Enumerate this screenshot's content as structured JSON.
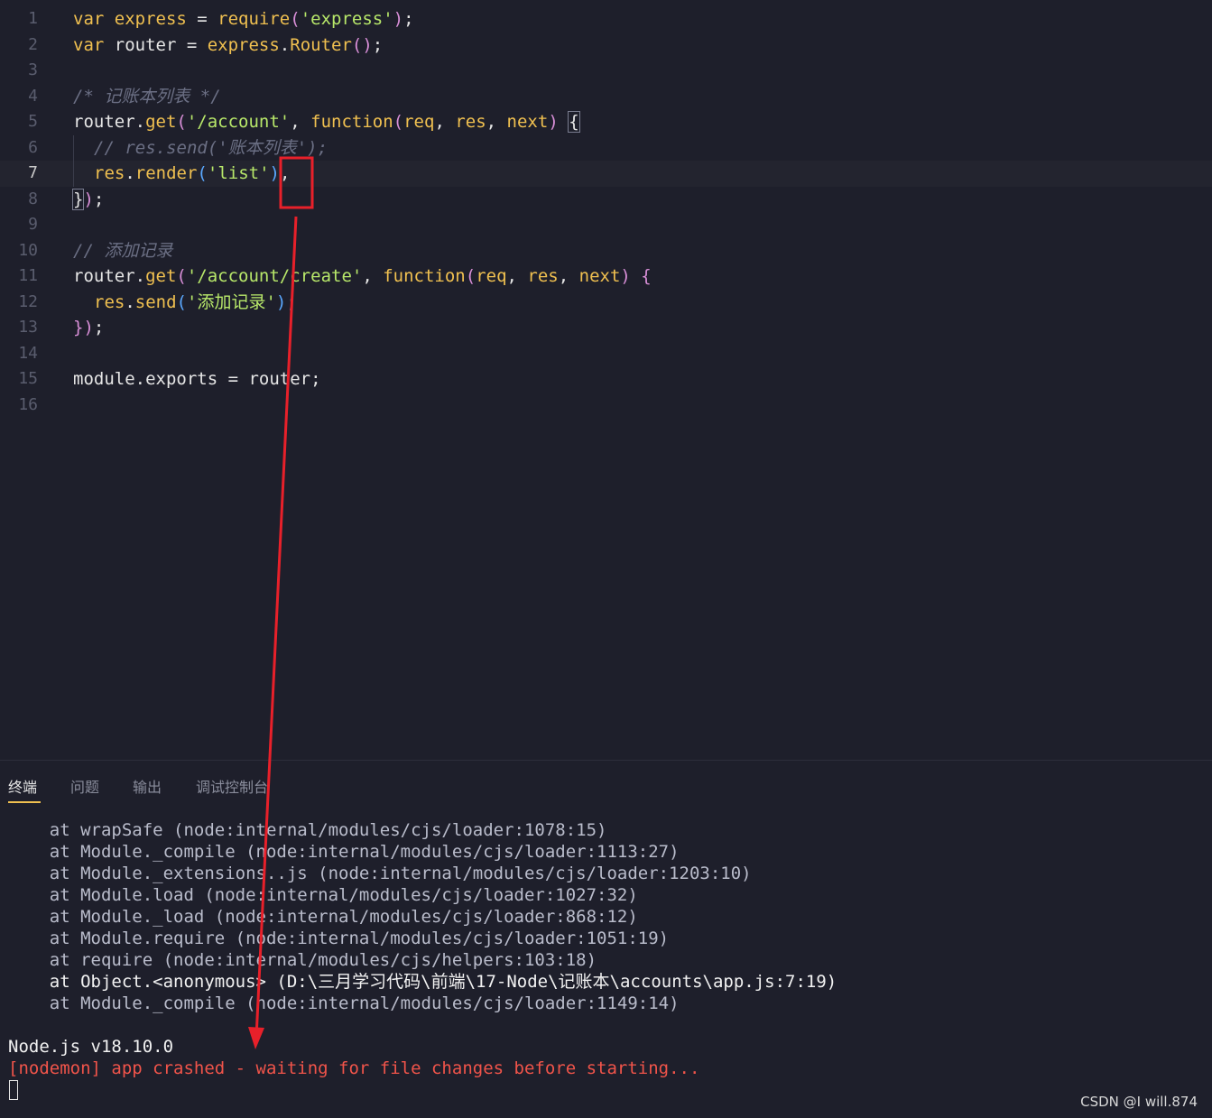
{
  "editor": {
    "lines": [
      {
        "n": "1",
        "indent": 0,
        "tokens": [
          [
            "kw",
            "var "
          ],
          [
            "fn",
            "express"
          ],
          [
            "punc",
            " = "
          ],
          [
            "fn",
            "require"
          ],
          [
            "paren",
            "("
          ],
          [
            "str",
            "'express'"
          ],
          [
            "paren",
            ")"
          ],
          [
            "punc",
            ";"
          ]
        ]
      },
      {
        "n": "2",
        "indent": 0,
        "tokens": [
          [
            "kw",
            "var "
          ],
          [
            "punc",
            "router = "
          ],
          [
            "fn",
            "express"
          ],
          [
            "punc",
            "."
          ],
          [
            "fn",
            "Router"
          ],
          [
            "paren",
            "()"
          ],
          [
            "punc",
            ";"
          ]
        ]
      },
      {
        "n": "3",
        "indent": 0,
        "tokens": []
      },
      {
        "n": "4",
        "indent": 0,
        "tokens": [
          [
            "cm",
            "/* 记账本列表 */"
          ]
        ]
      },
      {
        "n": "5",
        "indent": 0,
        "tokens": [
          [
            "punc",
            "router."
          ],
          [
            "fn",
            "get"
          ],
          [
            "paren",
            "("
          ],
          [
            "str",
            "'/account'"
          ],
          [
            "punc",
            ", "
          ],
          [
            "kw",
            "function"
          ],
          [
            "paren",
            "("
          ],
          [
            "param",
            "req"
          ],
          [
            "punc",
            ", "
          ],
          [
            "param",
            "res"
          ],
          [
            "punc",
            ", "
          ],
          [
            "param",
            "next"
          ],
          [
            "paren",
            ")"
          ],
          [
            "punc",
            " "
          ],
          [
            "bm",
            "{"
          ]
        ]
      },
      {
        "n": "6",
        "indent": 1,
        "tokens": [
          [
            "cm",
            "// res.send('账本列表');"
          ]
        ]
      },
      {
        "n": "7",
        "indent": 1,
        "tokens": [
          [
            "param",
            "res"
          ],
          [
            "punc",
            "."
          ],
          [
            "fn",
            "render"
          ],
          [
            "paren2",
            "("
          ],
          [
            "str",
            "'list'"
          ],
          [
            "paren2",
            ")"
          ],
          [
            "punc",
            ","
          ]
        ]
      },
      {
        "n": "8",
        "indent": 0,
        "tokens": [
          [
            "bm",
            "}"
          ],
          [
            "paren",
            ")"
          ],
          [
            "punc",
            ";"
          ]
        ]
      },
      {
        "n": "9",
        "indent": 0,
        "tokens": []
      },
      {
        "n": "10",
        "indent": 0,
        "tokens": [
          [
            "cm",
            "// 添加记录"
          ]
        ]
      },
      {
        "n": "11",
        "indent": 0,
        "tokens": [
          [
            "punc",
            "router."
          ],
          [
            "fn",
            "get"
          ],
          [
            "paren",
            "("
          ],
          [
            "str",
            "'/account/create'"
          ],
          [
            "punc",
            ", "
          ],
          [
            "kw",
            "function"
          ],
          [
            "paren",
            "("
          ],
          [
            "param",
            "req"
          ],
          [
            "punc",
            ", "
          ],
          [
            "param",
            "res"
          ],
          [
            "punc",
            ", "
          ],
          [
            "param",
            "next"
          ],
          [
            "paren",
            ")"
          ],
          [
            "punc",
            " "
          ],
          [
            "paren",
            "{"
          ]
        ]
      },
      {
        "n": "12",
        "indent": 1,
        "tokens": [
          [
            "param",
            "res"
          ],
          [
            "punc",
            "."
          ],
          [
            "fn",
            "send"
          ],
          [
            "paren2",
            "("
          ],
          [
            "str",
            "'添加记录'"
          ],
          [
            "paren2",
            ")"
          ],
          [
            "punc",
            ";"
          ]
        ]
      },
      {
        "n": "13",
        "indent": 0,
        "tokens": [
          [
            "paren",
            "}"
          ],
          [
            "paren",
            ")"
          ],
          [
            "punc",
            ";"
          ]
        ]
      },
      {
        "n": "14",
        "indent": 0,
        "tokens": []
      },
      {
        "n": "15",
        "indent": 0,
        "tokens": [
          [
            "punc",
            "module.exports = router;"
          ]
        ]
      },
      {
        "n": "16",
        "indent": 0,
        "tokens": []
      }
    ],
    "active_line": 7
  },
  "panel": {
    "tabs": [
      "终端",
      "问题",
      "输出",
      "调试控制台"
    ],
    "active_tab": 0
  },
  "terminal": {
    "stack": [
      "    at wrapSafe (node:internal/modules/cjs/loader:1078:15)",
      "    at Module._compile (node:internal/modules/cjs/loader:1113:27)",
      "    at Module._extensions..js (node:internal/modules/cjs/loader:1203:10)",
      "    at Module.load (node:internal/modules/cjs/loader:1027:32)",
      "    at Module._load (node:internal/modules/cjs/loader:868:12)",
      "    at Module.require (node:internal/modules/cjs/loader:1051:19)",
      "    at require (node:internal/modules/cjs/helpers:103:18)",
      "    at Object.<anonymous> (D:\\三月学习代码\\前端\\17-Node\\记账本\\accounts\\app.js:7:19)",
      "    at Module._compile (node:internal/modules/cjs/loader:1149:14)"
    ],
    "bright_stack_index": 7,
    "node_version": "Node.js v18.10.0",
    "crash_message": "[nodemon] app crashed - waiting for file changes before starting..."
  },
  "watermark": "CSDN @I will.874",
  "colors": {
    "annotation": "#e8202a",
    "background": "#1e1f2b"
  }
}
